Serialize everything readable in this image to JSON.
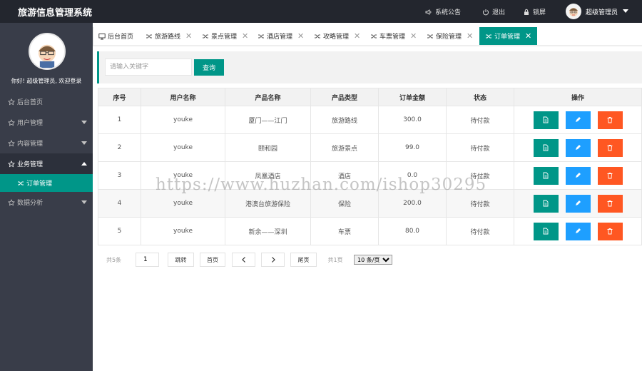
{
  "header": {
    "app_title": "旅游信息管理系统",
    "announcement": "系统公告",
    "logout": "退出",
    "lock": "锁屏",
    "user": "超级管理员"
  },
  "sidebar": {
    "welcome": "你好! 超级管理员, 欢迎登录",
    "items": [
      {
        "label": "后台首页"
      },
      {
        "label": "用户管理"
      },
      {
        "label": "内容管理"
      },
      {
        "label": "业务管理"
      },
      {
        "label": "数据分析"
      }
    ],
    "sub_active": "订单管理"
  },
  "tabs": [
    {
      "label": "后台首页"
    },
    {
      "label": "旅游路线"
    },
    {
      "label": "景点管理"
    },
    {
      "label": "酒店管理"
    },
    {
      "label": "攻略管理"
    },
    {
      "label": "车票管理"
    },
    {
      "label": "保险管理"
    },
    {
      "label": "订单管理"
    }
  ],
  "search": {
    "placeholder": "请输入关键字",
    "button": "查询"
  },
  "table": {
    "headers": [
      "序号",
      "用户名称",
      "产品名称",
      "产品类型",
      "订单金额",
      "状态",
      "操作"
    ],
    "rows": [
      [
        "1",
        "youke",
        "厦门——江门",
        "旅游路线",
        "300.0",
        "待付款"
      ],
      [
        "2",
        "youke",
        "颐和园",
        "旅游景点",
        "99.0",
        "待付款"
      ],
      [
        "3",
        "youke",
        "凤凰酒店",
        "酒店",
        "0.0",
        "待付款"
      ],
      [
        "4",
        "youke",
        "港澳台旅游保险",
        "保险",
        "200.0",
        "待付款"
      ],
      [
        "5",
        "youke",
        "新余——深圳",
        "车票",
        "80.0",
        "待付款"
      ]
    ]
  },
  "pager": {
    "total": "共5条",
    "page": "1",
    "jump": "跳转",
    "first": "首页",
    "last": "尾页",
    "pages": "共1页",
    "size": "10 条/页"
  },
  "watermark": "https://www.huzhan.com/ishop30295",
  "colors": {
    "accent": "#009688",
    "edit": "#1e9fff",
    "delete": "#ff5722",
    "topbar": "#23262e",
    "sidebar": "#393d49"
  }
}
